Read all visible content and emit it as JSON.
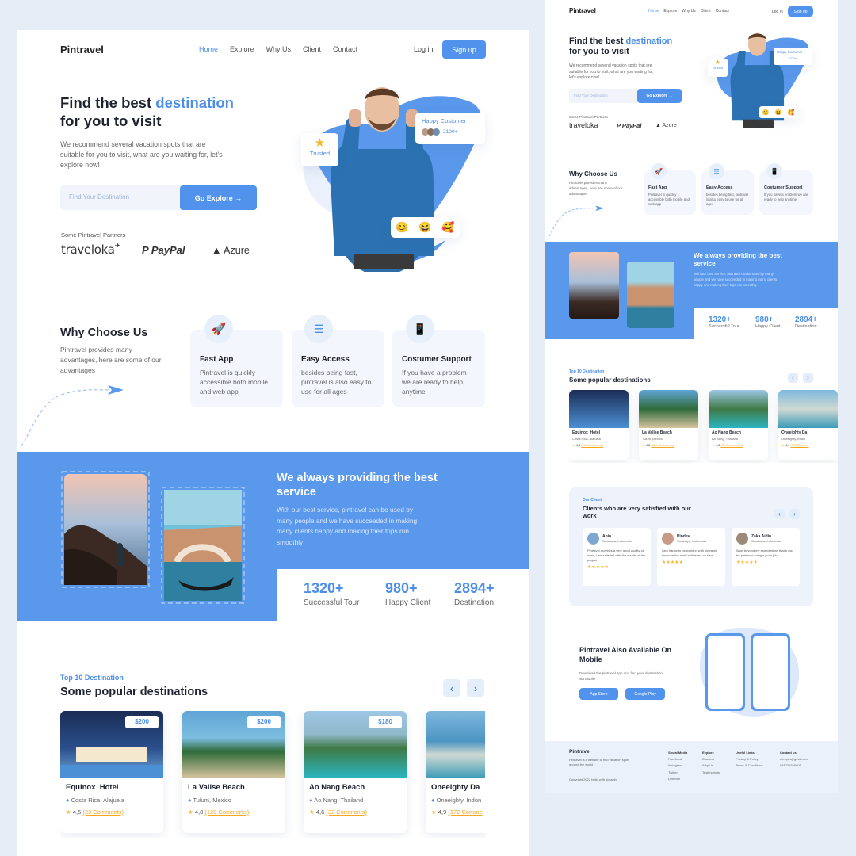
{
  "brand": "Pintravel",
  "nav": {
    "items": [
      "Home",
      "Explore",
      "Why Us",
      "Client",
      "Contact"
    ],
    "login": "Log in",
    "signup": "Sign up"
  },
  "hero": {
    "title_a": "Find the best",
    "title_b": "destination",
    "title_c": "for you to visit",
    "desc": "We recommend several vacation spots that are suitable for you to visit, what are you waiting for, let's explore now!",
    "search_placeholder": "Find Your Destination",
    "go_label": "Go Explore",
    "partners_label": "Some Pintravel Partners",
    "partners": [
      "traveloka",
      "PayPal",
      "Azure"
    ],
    "trusted": "Trusted",
    "happy_title": "Happy Costumer",
    "happy_count": "2100+",
    "emojis": [
      "😊",
      "😆",
      "🥰"
    ]
  },
  "why": {
    "title": "Why Choose Us",
    "desc": "Pintravel provides many advantages, here are some of our advantages",
    "features": [
      {
        "title": "Fast App",
        "desc": "Pintravel is quickly accessible both mobile and web app"
      },
      {
        "title": "Easy Access",
        "desc": "besides being fast, pintravel is also easy to use for all ages"
      },
      {
        "title": "Costumer Support",
        "desc": "If you have a problem we are ready to help anytime"
      }
    ]
  },
  "service": {
    "title": "We always providing the best service",
    "desc": "With our best service, pintravel can be used by many people and we have succeeded in making many clients happy and making their trips run smoothly",
    "stats": [
      {
        "num": "1320+",
        "label": "Successful Tour"
      },
      {
        "num": "980+",
        "label": "Happy Client"
      },
      {
        "num": "2894+",
        "label": "Destination"
      }
    ]
  },
  "popular": {
    "tag": "Top 10 Destination",
    "title": "Some popular destinations",
    "items": [
      {
        "name": "Equinox  Hotel",
        "loc": "Costa Rica, Alajuela",
        "price": "$200",
        "rating": "4,5",
        "comments": "(23 Comments)"
      },
      {
        "name": "La Valise Beach",
        "loc": "Tulum, Mexico",
        "price": "$200",
        "rating": "4,8",
        "comments": "(120 Comments)"
      },
      {
        "name": "Ao Nang Beach",
        "loc": "Ao Nang, Thailand",
        "price": "$180",
        "rating": "4,6",
        "comments": "(32 Comments)"
      },
      {
        "name": "Oneeighty Da",
        "loc": "Oneeighty, Indon",
        "price": "",
        "rating": "4,9",
        "comments": "(172 Comme"
      }
    ]
  },
  "clients": {
    "tag": "Our Client",
    "title": "Clients who are very satisfied with our work",
    "items": [
      {
        "name": "Apin",
        "loc": "Surabaya, Indonesia",
        "text": "Pintravel provides a very good quality of work, I am satisfied with the results of the project"
      },
      {
        "name": "Pindev",
        "loc": "Surabaya, Indonesia",
        "text": "I am happy to be working with pintravel because the work is finished on time"
      },
      {
        "name": "Zaka Aidin",
        "loc": "Surabaya, Indonesia",
        "text": "Wow beyond my expectations thank you for pintravel doing a good job"
      }
    ],
    "stars": "★★★★★"
  },
  "mobile": {
    "title": "Pintravel Also Available On Mobile",
    "desc": "Download the pintravel app and find your destination via mobile",
    "app_store": "App Store",
    "google_play": "Google Play"
  },
  "footer": {
    "brand": "Pintravel",
    "desc": "Pintravel is a website to find vacation spots around the world",
    "copy": "Copyright 2022 build with uix.apin",
    "cols": [
      {
        "title": "Social Media",
        "items": [
          "Facebook",
          "Instagram",
          "Twitter",
          "LinkedIn"
        ]
      },
      {
        "title": "Explore",
        "items": [
          "Discover",
          "Why Us",
          "Testimonials"
        ]
      },
      {
        "title": "Useful Links",
        "items": [
          "Privacy & Policy",
          "Terms & Conditions"
        ]
      },
      {
        "title": "Contact us",
        "items": [
          "uix.apin@gmail.com",
          "081231548805"
        ]
      }
    ]
  },
  "colors": {
    "accent": "#4d8fe8",
    "band": "#5a98ec",
    "bg": "#e6edf6"
  }
}
